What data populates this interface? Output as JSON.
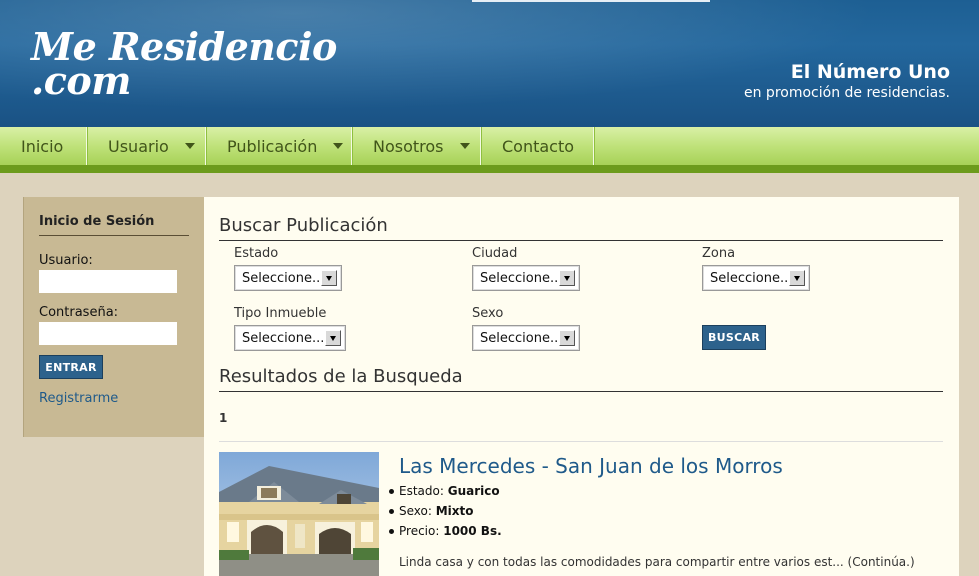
{
  "header": {
    "logo_line1": "Me Residencio",
    "logo_line2": ".com",
    "tagline_title": "El Número Uno",
    "tagline_sub": "en promoción de residencias."
  },
  "nav": {
    "items": [
      {
        "label": "Inicio",
        "has_dropdown": false
      },
      {
        "label": "Usuario",
        "has_dropdown": true
      },
      {
        "label": "Publicación",
        "has_dropdown": true
      },
      {
        "label": "Nosotros",
        "has_dropdown": true
      },
      {
        "label": "Contacto",
        "has_dropdown": false
      }
    ]
  },
  "login": {
    "title": "Inicio de Sesión",
    "user_label": "Usuario:",
    "user_value": "",
    "password_label": "Contraseña:",
    "password_value": "",
    "submit_label": "ENTRAR",
    "register_link": "Registrarme"
  },
  "search": {
    "title": "Buscar Publicación",
    "fields": {
      "estado": {
        "label": "Estado",
        "value": "Seleccione..."
      },
      "ciudad": {
        "label": "Ciudad",
        "value": "Seleccione..."
      },
      "zona": {
        "label": "Zona",
        "value": "Seleccione..."
      },
      "tipo": {
        "label": "Tipo Inmueble",
        "value": "Seleccione..."
      },
      "sexo": {
        "label": "Sexo",
        "value": "Seleccione..."
      }
    },
    "submit_label": "BUSCAR"
  },
  "results": {
    "title": "Resultados de la Busqueda",
    "page": "1",
    "items": [
      {
        "title": "Las Mercedes - San Juan de los Morros",
        "estado_label": "Estado:",
        "estado": "Guarico",
        "sexo_label": "Sexo:",
        "sexo": "Mixto",
        "precio_label": "Precio:",
        "precio": "1000 Bs.",
        "description": "Linda casa y con todas las comodidades para compartir entre varios est... (Continúa.)"
      }
    ]
  },
  "colors": {
    "header_blue": "#1d5f93",
    "nav_green": "#bfe27a",
    "button_blue": "#2d628c",
    "link_blue": "#1f5a8a",
    "sidebar_tan": "#c8b994"
  }
}
